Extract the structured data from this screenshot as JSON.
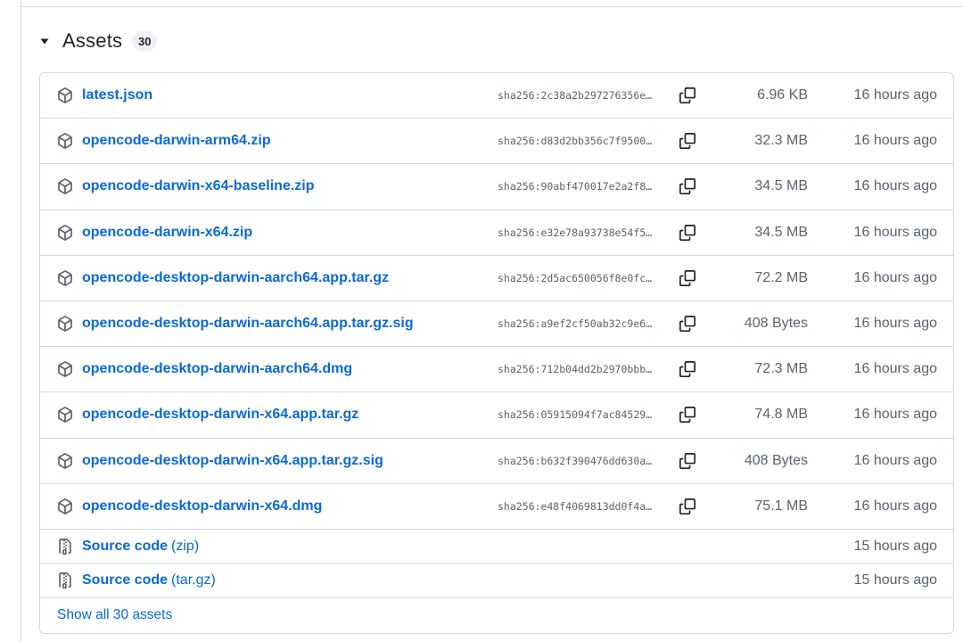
{
  "assets": {
    "title": "Assets",
    "count": "30",
    "items": [
      {
        "name": "latest.json",
        "sha": "sha256:2c38a2b297276356e…",
        "size": "6.96 KB",
        "time": "16 hours ago"
      },
      {
        "name": "opencode-darwin-arm64.zip",
        "sha": "sha256:d83d2bb356c7f9500…",
        "size": "32.3 MB",
        "time": "16 hours ago"
      },
      {
        "name": "opencode-darwin-x64-baseline.zip",
        "sha": "sha256:90abf470017e2a2f8…",
        "size": "34.5 MB",
        "time": "16 hours ago"
      },
      {
        "name": "opencode-darwin-x64.zip",
        "sha": "sha256:e32e78a93738e54f5…",
        "size": "34.5 MB",
        "time": "16 hours ago"
      },
      {
        "name": "opencode-desktop-darwin-aarch64.app.tar.gz",
        "sha": "sha256:2d5ac650056f8e0fc…",
        "size": "72.2 MB",
        "time": "16 hours ago"
      },
      {
        "name": "opencode-desktop-darwin-aarch64.app.tar.gz.sig",
        "sha": "sha256:a9ef2cf50ab32c9e6…",
        "size": "408 Bytes",
        "time": "16 hours ago"
      },
      {
        "name": "opencode-desktop-darwin-aarch64.dmg",
        "sha": "sha256:712b04dd2b2970bbb…",
        "size": "72.3 MB",
        "time": "16 hours ago"
      },
      {
        "name": "opencode-desktop-darwin-x64.app.tar.gz",
        "sha": "sha256:05915094f7ac84529…",
        "size": "74.8 MB",
        "time": "16 hours ago"
      },
      {
        "name": "opencode-desktop-darwin-x64.app.tar.gz.sig",
        "sha": "sha256:b632f390476dd630a…",
        "size": "408 Bytes",
        "time": "16 hours ago"
      },
      {
        "name": "opencode-desktop-darwin-x64.dmg",
        "sha": "sha256:e48f4069813dd0f4a…",
        "size": "75.1 MB",
        "time": "16 hours ago"
      }
    ],
    "sources": [
      {
        "label": "Source code",
        "format": "(zip)",
        "time": "15 hours ago"
      },
      {
        "label": "Source code",
        "format": "(tar.gz)",
        "time": "15 hours ago"
      }
    ],
    "show_all_label": "Show all 30 assets"
  },
  "icons": {
    "caret": "triangle-down-icon",
    "asset": "package-icon",
    "copy": "copy-icon",
    "source": "file-zip-icon"
  },
  "colors": {
    "link": "#0969da",
    "muted": "#59636e",
    "border": "#d1d9e0",
    "badge_bg": "#eef0f3"
  }
}
